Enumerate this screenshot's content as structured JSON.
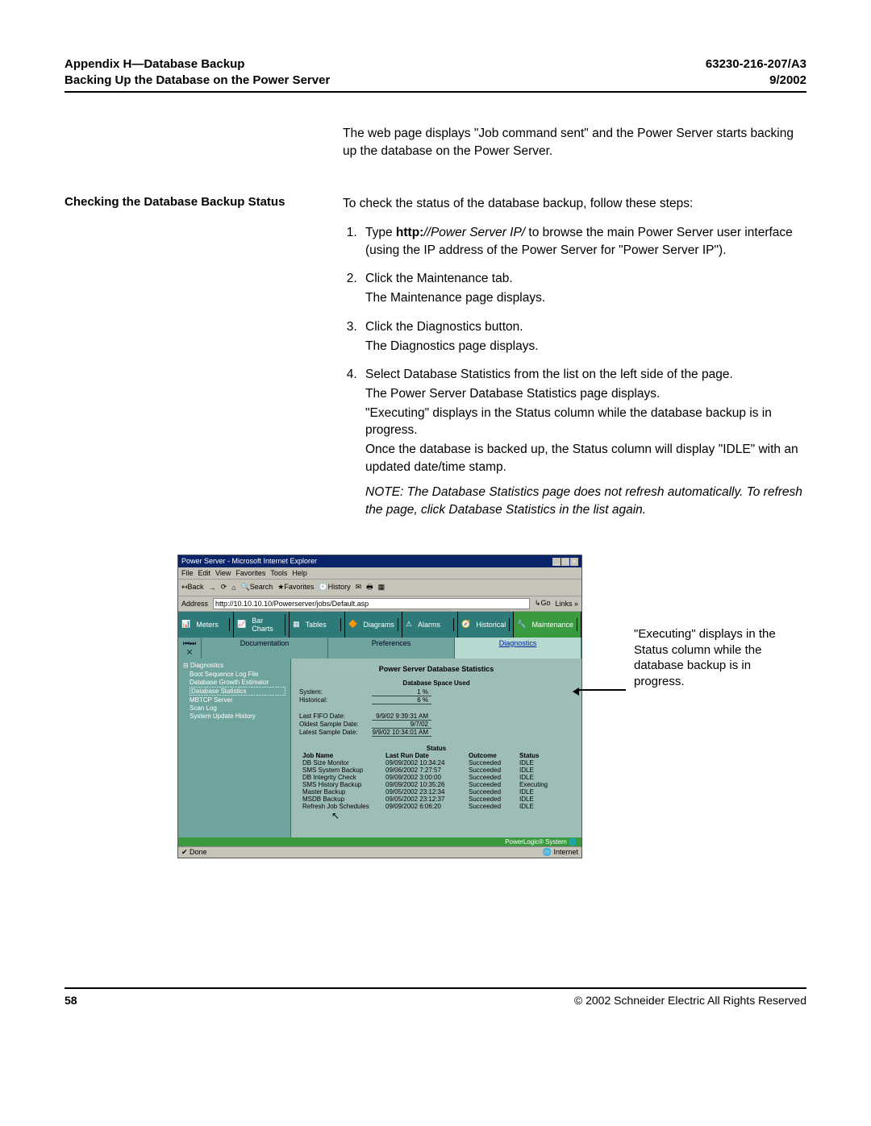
{
  "header": {
    "left1": "Appendix H—Database Backup",
    "left2": "Backing Up the Database on the Power Server",
    "right1": "63230-216-207/A3",
    "right2": "9/2002"
  },
  "intro_para": "The web page displays \"Job command sent\" and the Power Server starts backing up the database on the Power Server.",
  "section_heading": "Checking the Database Backup Status",
  "section_lead": "To check the status of the database backup, follow these steps:",
  "steps": {
    "s1a": "Type ",
    "s1b_bold": "http:",
    "s1c_ital": "//Power Server IP/",
    "s1d": " to browse the main Power Server user interface (using the IP address of the Power Server for \"Power Server IP\").",
    "s2a": "Click the Maintenance tab.",
    "s2b": "The Maintenance page displays.",
    "s3a": "Click the Diagnostics button.",
    "s3b": "The Diagnostics page displays.",
    "s4a": "Select Database Statistics from the list on the left side of the page.",
    "s4b": "The Power Server Database Statistics page displays.",
    "s4c": "\"Executing\" displays in the Status column while the database backup is in progress.",
    "s4d": "Once the database is backed up, the Status column will display \"IDLE\" with an updated date/time stamp.",
    "note": "NOTE: The Database Statistics page does not refresh automatically. To refresh the page, click Database Statistics in the list again."
  },
  "callout_text": "\"Executing\" displays in the Status column while the database backup is in progress.",
  "browser": {
    "title": "Power Server - Microsoft Internet Explorer",
    "menus": [
      "File",
      "Edit",
      "View",
      "Favorites",
      "Tools",
      "Help"
    ],
    "toolbar": [
      "↤Back",
      "→",
      "·",
      "⟳",
      "⌂",
      "🔍Search",
      "★Favorites",
      "🕘History",
      "✉",
      "🖶",
      "▦",
      "·",
      "☐"
    ],
    "addr_label": "Address",
    "addr_url": "http://10.10.10.10/Powerserver/jobs/Default.asp",
    "addr_go": "↳Go",
    "addr_links": "Links »",
    "tabs": [
      "Meters",
      "Bar Charts",
      "Tables",
      "Diagrams",
      "Alarms",
      "Historical",
      "Maintenance"
    ],
    "subtabs": {
      "doc": "Documentation",
      "pref": "Preferences",
      "diag": "Diagnostics"
    },
    "tree": {
      "root": "⊟ Diagnostics",
      "items": [
        "Boot Sequence Log File",
        "Database Growth Estimator",
        "Database Statistics",
        "MBTCP Server",
        "Scan Log",
        "System Update History"
      ]
    },
    "panel_title": "Power Server Database Statistics",
    "space_head": "Database Space Used",
    "space": {
      "system_k": "System:",
      "system_v": "1 %",
      "hist_k": "Historical:",
      "hist_v": "6 %"
    },
    "dates": {
      "lf_k": "Last FIFO Date:",
      "lf_v": "9/9/02 9:39:31 AM",
      "os_k": "Oldest Sample Date:",
      "os_v": "9/7/02",
      "ls_k": "Latest Sample Date:",
      "ls_v": "9/9/02 10:34:01 AM"
    },
    "status_head": "Status",
    "thead": {
      "c0": "Job Name",
      "c1": "Last Run Date",
      "c2": "Outcome",
      "c3": "Status"
    },
    "jobs": [
      {
        "c0": "DB Size Monitor",
        "c1": "09/09/2002 10:34:24",
        "c2": "Succeeded",
        "c3": "IDLE"
      },
      {
        "c0": "SMS System Backup",
        "c1": "09/06/2002 7:27:57",
        "c2": "Succeeded",
        "c3": "IDLE"
      },
      {
        "c0": "DB Integrity Check",
        "c1": "09/09/2002 3:00:00",
        "c2": "Succeeded",
        "c3": "IDLE"
      },
      {
        "c0": "SMS History Backup",
        "c1": "09/09/2002 10:35:26",
        "c2": "Succeeded",
        "c3": "Executing"
      },
      {
        "c0": "Master Backup",
        "c1": "09/05/2002 23:12:34",
        "c2": "Succeeded",
        "c3": "IDLE"
      },
      {
        "c0": "MSDB Backup",
        "c1": "09/05/2002 23:12:37",
        "c2": "Succeeded",
        "c3": "IDLE"
      },
      {
        "c0": "Refresh Job Schedules",
        "c1": "09/09/2002 6:06:20",
        "c2": "Succeeded",
        "c3": "IDLE"
      }
    ],
    "pl_footer": "PowerLogic® System 🌐",
    "status_left": "✔ Done",
    "status_right": "🌐 Internet"
  },
  "footer": {
    "page": "58",
    "copy": "© 2002 Schneider Electric  All Rights Reserved"
  }
}
